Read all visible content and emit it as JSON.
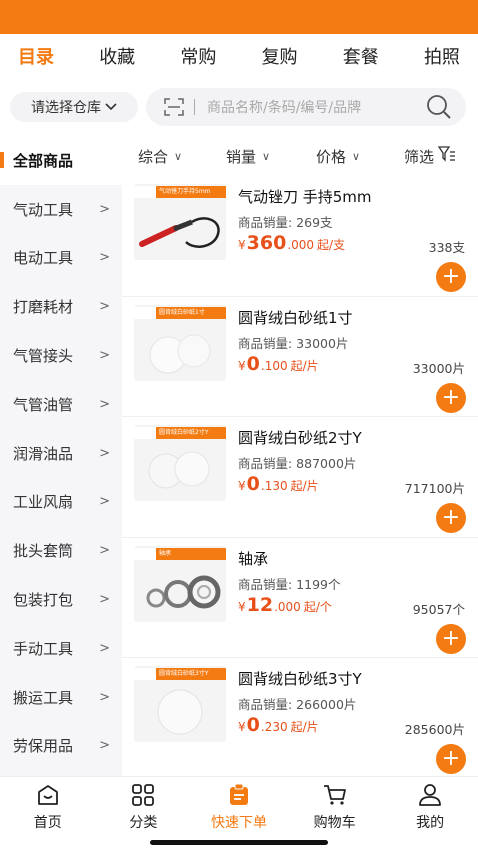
{
  "top_tabs": [
    "目录",
    "收藏",
    "常购",
    "复购",
    "套餐",
    "拍照"
  ],
  "warehouse": {
    "label": "请选择仓库"
  },
  "search": {
    "placeholder": "商品名称/条码/编号/品牌"
  },
  "sidebar": {
    "items": [
      "全部商品",
      "气动工具",
      "电动工具",
      "打磨耗材",
      "气管接头",
      "气管油管",
      "润滑油品",
      "工业风扇",
      "批头套筒",
      "包装打包",
      "手动工具",
      "搬运工具",
      "劳保用品"
    ]
  },
  "filters": [
    "综合",
    "销量",
    "价格",
    "筛选"
  ],
  "products": [
    {
      "name": "气动锉刀 手持5mm",
      "tag": "气动锉刀手持5mm",
      "sales": "商品销量: 269支",
      "currency": "¥",
      "price_int": "360",
      "price_dec": ".000",
      "unit": "起/支",
      "stock": "338支"
    },
    {
      "name": "圆背绒白砂纸1寸",
      "tag": "圆背绒白砂纸1寸",
      "sales": "商品销量: 33000片",
      "currency": "¥",
      "price_int": "0",
      "price_dec": ".100",
      "unit": "起/片",
      "stock": "33000片"
    },
    {
      "name": "圆背绒白砂纸2寸Y",
      "tag": "圆背绒白砂纸2寸Y",
      "sales": "商品销量: 887000片",
      "currency": "¥",
      "price_int": "0",
      "price_dec": ".130",
      "unit": "起/片",
      "stock": "717100片"
    },
    {
      "name": "轴承",
      "tag": "轴承",
      "sales": "商品销量: 1199个",
      "currency": "¥",
      "price_int": "12",
      "price_dec": ".000",
      "unit": "起/个",
      "stock": "95057个"
    },
    {
      "name": "圆背绒白砂纸3寸Y",
      "tag": "圆背绒白砂纸3寸Y",
      "sales": "商品销量: 266000片",
      "currency": "¥",
      "price_int": "0",
      "price_dec": ".230",
      "unit": "起/片",
      "stock": "285600片"
    }
  ],
  "bottom_nav": [
    "首页",
    "分类",
    "快速下单",
    "购物车",
    "我的"
  ],
  "colors": {
    "accent": "#f47a12",
    "price": "#e8501a"
  }
}
